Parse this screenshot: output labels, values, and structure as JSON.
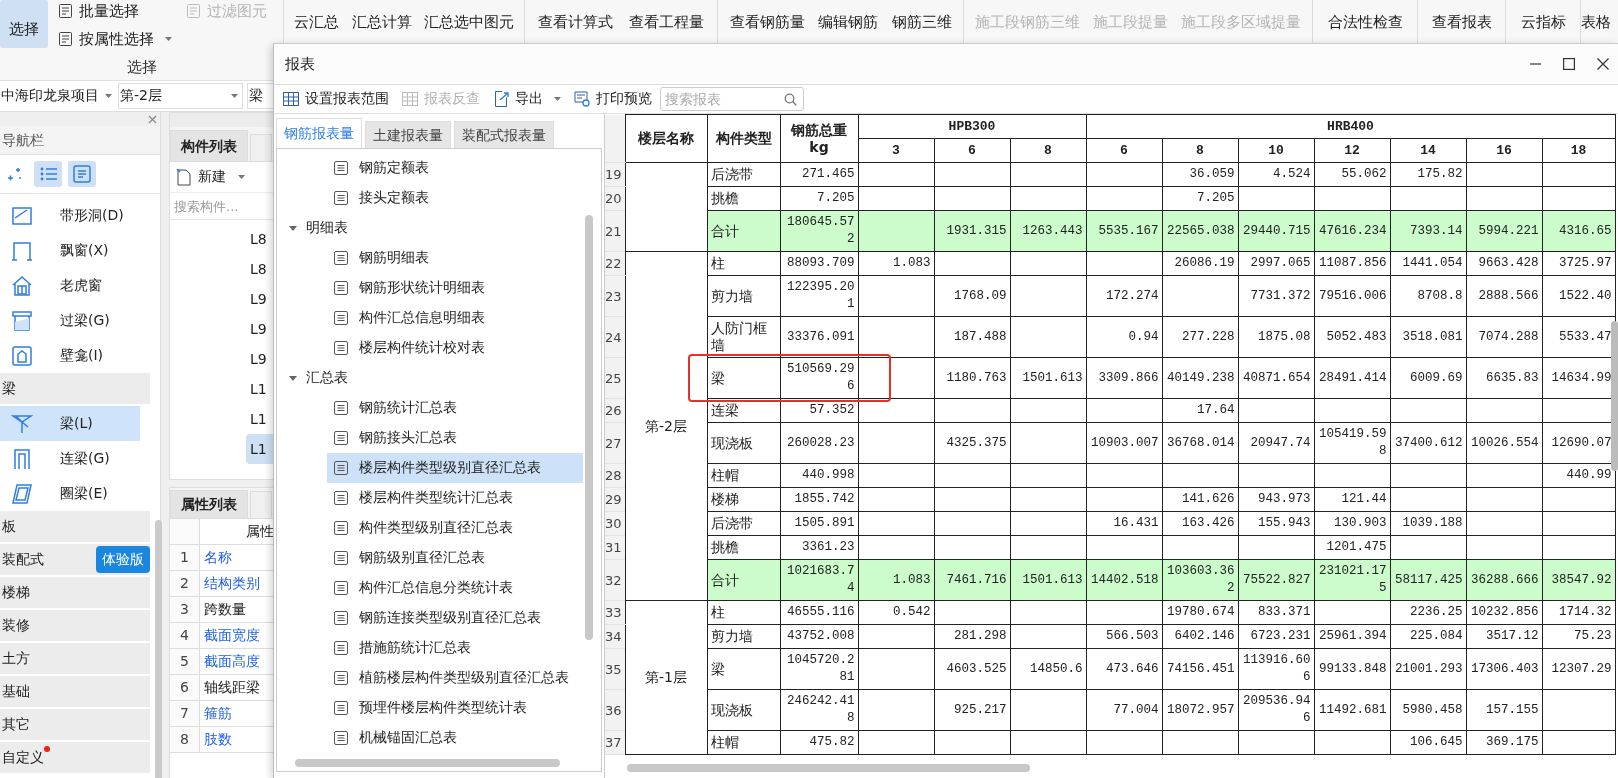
{
  "ribbon": {
    "groups": [
      {
        "label": "选择",
        "buttons": [
          {
            "label": "选择",
            "kind": "large",
            "selected": true,
            "disabled": false,
            "dropdown": false
          },
          {
            "label": "批量选择",
            "kind": "small",
            "selected": false,
            "disabled": false,
            "dropdown": false
          },
          {
            "label": "按属性选择",
            "kind": "small",
            "selected": false,
            "disabled": false,
            "dropdown": true
          },
          {
            "label": "过滤图元",
            "kind": "small",
            "selected": false,
            "disabled": true,
            "dropdown": false
          }
        ]
      },
      {
        "buttons": [
          {
            "label": "云汇总",
            "kind": "large",
            "selected": false,
            "disabled": false,
            "dropdown": false
          },
          {
            "label": "汇总计算",
            "kind": "large",
            "selected": false,
            "disabled": false,
            "dropdown": false
          },
          {
            "label": "汇总选中图元",
            "kind": "large",
            "selected": false,
            "disabled": false,
            "dropdown": false
          }
        ]
      },
      {
        "buttons": [
          {
            "label": "查看计算式",
            "kind": "large",
            "selected": false,
            "disabled": false,
            "dropdown": false
          },
          {
            "label": "查看工程量",
            "kind": "large",
            "selected": false,
            "disabled": false,
            "dropdown": false
          }
        ]
      },
      {
        "buttons": [
          {
            "label": "查看钢筋量",
            "kind": "large",
            "selected": false,
            "disabled": false,
            "dropdown": false
          },
          {
            "label": "编辑钢筋",
            "kind": "large",
            "selected": false,
            "disabled": false,
            "dropdown": false
          },
          {
            "label": "钢筋三维",
            "kind": "large",
            "selected": false,
            "disabled": false,
            "dropdown": false
          }
        ]
      },
      {
        "buttons": [
          {
            "label": "施工段钢筋三维",
            "kind": "large",
            "selected": false,
            "disabled": true,
            "dropdown": false
          },
          {
            "label": "施工段提量",
            "kind": "large",
            "selected": false,
            "disabled": true,
            "dropdown": false
          },
          {
            "label": "施工段多区域提量",
            "kind": "large",
            "selected": false,
            "disabled": true,
            "dropdown": false
          }
        ]
      },
      {
        "buttons": [
          {
            "label": "合法性检查",
            "kind": "large",
            "selected": false,
            "disabled": false,
            "dropdown": false
          }
        ]
      },
      {
        "buttons": [
          {
            "label": "查看报表",
            "kind": "large",
            "selected": false,
            "disabled": false,
            "dropdown": false
          }
        ]
      },
      {
        "buttons": [
          {
            "label": "云指标",
            "kind": "large",
            "selected": false,
            "disabled": false,
            "dropdown": false
          }
        ]
      },
      {
        "buttons": [
          {
            "label": "表格",
            "kind": "large",
            "selected": false,
            "disabled": false,
            "dropdown": false
          }
        ]
      }
    ]
  },
  "project_bar": {
    "selectors": [
      {
        "value": "中海印龙泉项目"
      },
      {
        "value": "第-2层"
      },
      {
        "value": "梁"
      }
    ]
  },
  "navigator": {
    "title": "导航栏",
    "view_buttons": [
      {
        "kind": "add",
        "selected": false
      },
      {
        "kind": "list",
        "selected": true
      },
      {
        "kind": "detail",
        "selected": true
      }
    ],
    "items": [
      {
        "kind": "item",
        "label": "带形洞(D)",
        "selected": false
      },
      {
        "kind": "item",
        "label": "飘窗(X)",
        "selected": false
      },
      {
        "kind": "item",
        "label": "老虎窗",
        "selected": false
      },
      {
        "kind": "item",
        "label": "过梁(G)",
        "selected": false
      },
      {
        "kind": "item",
        "label": "壁龛(I)",
        "selected": false
      },
      {
        "kind": "category",
        "label": "梁",
        "notice": false,
        "children": [
          {
            "kind": "item",
            "label": "梁(L)",
            "selected": true
          },
          {
            "kind": "item",
            "label": "连梁(G)",
            "selected": false
          },
          {
            "kind": "item",
            "label": "圈梁(E)",
            "selected": false
          }
        ]
      },
      {
        "kind": "category",
        "label": "板",
        "notice": false
      },
      {
        "kind": "category",
        "label": "装配式",
        "badge": "体验版",
        "notice": false
      },
      {
        "kind": "category",
        "label": "楼梯",
        "notice": false
      },
      {
        "kind": "category",
        "label": "装修",
        "notice": false
      },
      {
        "kind": "category",
        "label": "土方",
        "notice": false
      },
      {
        "kind": "category",
        "label": "基础",
        "notice": false
      },
      {
        "kind": "category",
        "label": "其它",
        "notice": false
      },
      {
        "kind": "category",
        "label": "自定义",
        "notice": true
      }
    ]
  },
  "component_list": {
    "tabs": [
      {
        "label": "构件列表",
        "selected": true
      }
    ],
    "new_button": "新建",
    "search": {
      "placeholder": "搜索构件..."
    },
    "items": [
      {
        "label": "L8",
        "selected": false
      },
      {
        "label": "L8",
        "selected": false
      },
      {
        "label": "L9",
        "selected": false
      },
      {
        "label": "L9",
        "selected": false
      },
      {
        "label": "L9",
        "selected": false
      },
      {
        "label": "L1",
        "selected": false
      },
      {
        "label": "L1",
        "selected": false
      },
      {
        "label": "L1",
        "selected": true
      }
    ]
  },
  "properties": {
    "tabs": [
      {
        "label": "属性列表",
        "selected": true
      }
    ],
    "column": "属性",
    "rows": [
      {
        "index": "1",
        "name": "名称",
        "public": true
      },
      {
        "index": "2",
        "name": "结构类别",
        "public": true
      },
      {
        "index": "3",
        "name": "跨数量",
        "public": false
      },
      {
        "index": "4",
        "name": "截面宽度",
        "public": true
      },
      {
        "index": "5",
        "name": "截面高度",
        "public": true
      },
      {
        "index": "6",
        "name": "轴线距梁",
        "public": false
      },
      {
        "index": "7",
        "name": "箍筋",
        "public": true
      },
      {
        "index": "8",
        "name": "肢数",
        "public": true
      }
    ]
  },
  "report_dialog": {
    "title": "报表",
    "toolbar": [
      {
        "label": "设置报表范围",
        "disabled": false,
        "dropdown": false
      },
      {
        "label": "报表反查",
        "disabled": true,
        "dropdown": false
      },
      {
        "label": "导出",
        "disabled": false,
        "dropdown": true
      },
      {
        "label": "打印预览",
        "disabled": false,
        "dropdown": false
      }
    ],
    "search": {
      "placeholder": "搜索报表"
    },
    "tabs": [
      {
        "label": "钢筋报表量",
        "selected": true
      },
      {
        "label": "土建报表量",
        "selected": false
      },
      {
        "label": "装配式报表量",
        "selected": false
      }
    ],
    "tree": [
      {
        "kind": "report",
        "label": "钢筋定额表",
        "selected": false
      },
      {
        "kind": "report",
        "label": "接头定额表",
        "selected": false
      },
      {
        "kind": "group",
        "label": "明细表",
        "expanded": true,
        "children": [
          {
            "kind": "report",
            "label": "钢筋明细表",
            "selected": false
          },
          {
            "kind": "report",
            "label": "钢筋形状统计明细表",
            "selected": false
          },
          {
            "kind": "report",
            "label": "构件汇总信息明细表",
            "selected": false
          },
          {
            "kind": "report",
            "label": "楼层构件统计校对表",
            "selected": false
          }
        ]
      },
      {
        "kind": "group",
        "label": "汇总表",
        "expanded": true,
        "children": [
          {
            "kind": "report",
            "label": "钢筋统计汇总表",
            "selected": false
          },
          {
            "kind": "report",
            "label": "钢筋接头汇总表",
            "selected": false
          },
          {
            "kind": "report",
            "label": "楼层构件类型级别直径汇总表",
            "selected": true
          },
          {
            "kind": "report",
            "label": "楼层构件类型统计汇总表",
            "selected": false
          },
          {
            "kind": "report",
            "label": "构件类型级别直径汇总表",
            "selected": false
          },
          {
            "kind": "report",
            "label": "钢筋级别直径汇总表",
            "selected": false
          },
          {
            "kind": "report",
            "label": "构件汇总信息分类统计表",
            "selected": false
          },
          {
            "kind": "report",
            "label": "钢筋连接类型级别直径汇总表",
            "selected": false
          },
          {
            "kind": "report",
            "label": "措施筋统计汇总表",
            "selected": false
          },
          {
            "kind": "report",
            "label": "植筋楼层构件类型级别直径汇总表",
            "selected": false
          },
          {
            "kind": "report",
            "label": "预埋件楼层构件类型统计表",
            "selected": false
          },
          {
            "kind": "report",
            "label": "机械锚固汇总表",
            "selected": false
          }
        ]
      }
    ],
    "table": {
      "columns": [
        {
          "label": "楼层名称"
        },
        {
          "label": "构件类型"
        },
        {
          "label": "钢筋总重\nkg"
        }
      ],
      "grades": [
        {
          "label": "HPB300",
          "diameters": [
            "3",
            "6",
            "8"
          ]
        },
        {
          "label": "HRB400",
          "diameters": [
            "6",
            "8",
            "10",
            "12",
            "14",
            "16",
            "18"
          ]
        }
      ],
      "floors": [
        {
          "rows": [
            {
              "no": "19",
              "type": "后浇带",
              "total": "271.465",
              "values": {
                "c5": "36.059",
                "c6": "4.524",
                "c7": "55.062",
                "c8": "175.82"
              },
              "subtotal": false,
              "highlighted": false
            },
            {
              "no": "20",
              "type": "挑檐",
              "total": "7.205",
              "values": {
                "c5": "7.205"
              },
              "subtotal": false,
              "highlighted": false
            },
            {
              "no": "21",
              "type": "合计",
              "total": "180645.572",
              "values": {
                "c2": "1931.315",
                "c3": "1263.443",
                "c4": "5535.167",
                "c5": "22565.038",
                "c6": "29440.715",
                "c7": "47616.234",
                "c8": "7393.14",
                "c9": "5994.221",
                "c10": "4316.65"
              },
              "subtotal": true,
              "highlighted": false
            }
          ]
        },
        {
          "name": "第-2层",
          "rows": [
            {
              "no": "22",
              "type": "柱",
              "total": "88093.709",
              "values": {
                "c1": "1.083",
                "c5": "26086.19",
                "c6": "2997.065",
                "c7": "11087.856",
                "c8": "1441.054",
                "c9": "9663.428",
                "c10": "3725.97"
              },
              "subtotal": false,
              "highlighted": false
            },
            {
              "no": "23",
              "type": "剪力墙",
              "total": "122395.201",
              "values": {
                "c2": "1768.09",
                "c4": "172.274",
                "c6": "7731.372",
                "c7": "79516.006",
                "c8": "8708.8",
                "c9": "2888.566",
                "c10": "1522.40"
              },
              "subtotal": false,
              "highlighted": false
            },
            {
              "no": "24",
              "type": "人防门框墙",
              "total": "33376.091",
              "values": {
                "c2": "187.488",
                "c4": "0.94",
                "c5": "277.228",
                "c6": "1875.08",
                "c7": "5052.483",
                "c8": "3518.081",
                "c9": "7074.288",
                "c10": "5533.47"
              },
              "subtotal": false,
              "highlighted": false
            },
            {
              "no": "25",
              "type": "梁",
              "total": "510569.296",
              "values": {
                "c2": "1180.763",
                "c3": "1501.613",
                "c4": "3309.866",
                "c5": "40149.238",
                "c6": "40871.654",
                "c7": "28491.414",
                "c8": "6009.69",
                "c9": "6635.83",
                "c10": "14634.99"
              },
              "subtotal": false,
              "highlighted": true
            },
            {
              "no": "26",
              "type": "连梁",
              "total": "57.352",
              "values": {
                "c5": "17.64"
              },
              "subtotal": false,
              "highlighted": false
            },
            {
              "no": "27",
              "type": "现浇板",
              "total": "260028.23",
              "values": {
                "c2": "4325.375",
                "c4": "10903.007",
                "c5": "36768.014",
                "c6": "20947.74",
                "c7": "105419.598",
                "c8": "37400.612",
                "c9": "10026.554",
                "c10": "12690.07"
              },
              "subtotal": false,
              "highlighted": false
            },
            {
              "no": "28",
              "type": "柱帽",
              "total": "440.998",
              "values": {
                "c10": "440.99"
              },
              "subtotal": false,
              "highlighted": false
            },
            {
              "no": "29",
              "type": "楼梯",
              "total": "1855.742",
              "values": {
                "c5": "141.626",
                "c6": "943.973",
                "c7": "121.44"
              },
              "subtotal": false,
              "highlighted": false
            },
            {
              "no": "30",
              "type": "后浇带",
              "total": "1505.891",
              "values": {
                "c4": "16.431",
                "c5": "163.426",
                "c6": "155.943",
                "c7": "130.903",
                "c8": "1039.188"
              },
              "subtotal": false,
              "highlighted": false
            },
            {
              "no": "31",
              "type": "挑檐",
              "total": "3361.23",
              "values": {
                "c7": "1201.475"
              },
              "subtotal": false,
              "highlighted": false
            },
            {
              "no": "32",
              "type": "合计",
              "total": "1021683.74",
              "values": {
                "c1": "1.083",
                "c2": "7461.716",
                "c3": "1501.613",
                "c4": "14402.518",
                "c5": "103603.362",
                "c6": "75522.827",
                "c7": "231021.175",
                "c8": "58117.425",
                "c9": "36288.666",
                "c10": "38547.92"
              },
              "subtotal": true,
              "highlighted": false
            }
          ]
        },
        {
          "name": "第-1层",
          "rows": [
            {
              "no": "33",
              "type": "柱",
              "total": "46555.116",
              "values": {
                "c1": "0.542",
                "c5": "19780.674",
                "c6": "833.371",
                "c8": "2236.25",
                "c9": "10232.856",
                "c10": "1714.32"
              },
              "subtotal": false,
              "highlighted": false
            },
            {
              "no": "34",
              "type": "剪力墙",
              "total": "43752.008",
              "values": {
                "c2": "281.298",
                "c4": "566.503",
                "c5": "6402.146",
                "c6": "6723.231",
                "c7": "25961.394",
                "c8": "225.084",
                "c9": "3517.12",
                "c10": "75.23"
              },
              "subtotal": false,
              "highlighted": false
            },
            {
              "no": "35",
              "type": "梁",
              "total": "1045720.281",
              "values": {
                "c2": "4603.525",
                "c3": "14850.6",
                "c4": "473.646",
                "c5": "74156.451",
                "c6": "113916.606",
                "c7": "99133.848",
                "c8": "21001.293",
                "c9": "17306.403",
                "c10": "12307.29"
              },
              "subtotal": false,
              "highlighted": false
            },
            {
              "no": "36",
              "type": "现浇板",
              "total": "246242.418",
              "values": {
                "c2": "925.217",
                "c4": "77.004",
                "c5": "18072.957",
                "c6": "209536.946",
                "c7": "11492.681",
                "c8": "5980.458",
                "c9": "157.155"
              },
              "subtotal": false,
              "highlighted": false
            },
            {
              "no": "37",
              "type": "柱帽",
              "total": "475.82",
              "values": {
                "c8": "106.645",
                "c9": "369.175"
              },
              "subtotal": false,
              "highlighted": false
            }
          ]
        }
      ]
    }
  }
}
